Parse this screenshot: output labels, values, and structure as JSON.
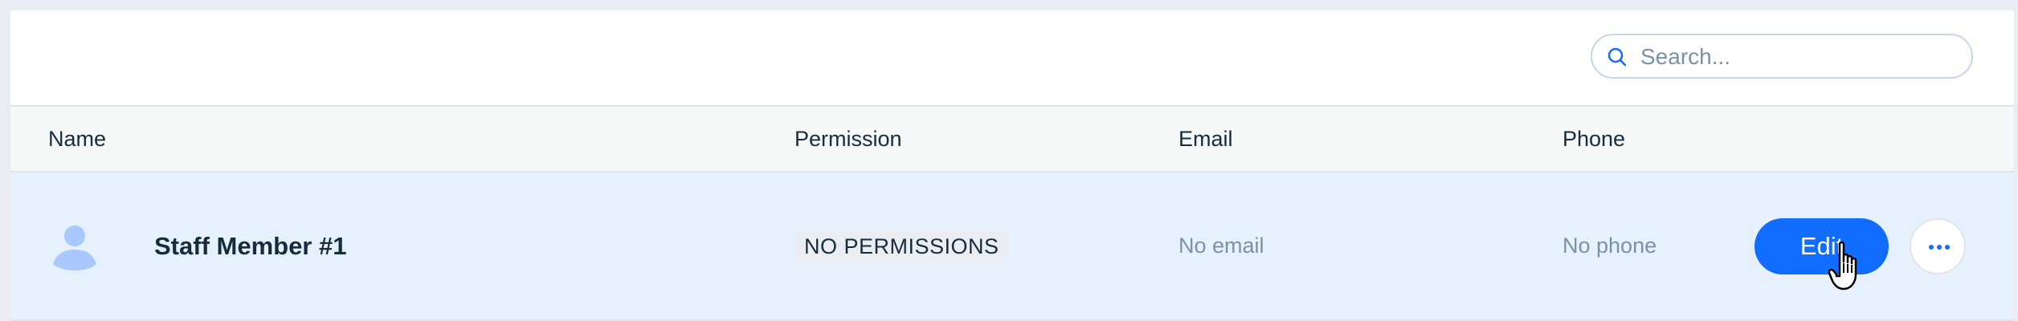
{
  "toolbar": {
    "search": {
      "placeholder": "Search...",
      "value": "",
      "icon": "search-icon"
    }
  },
  "table": {
    "columns": [
      "Name",
      "Permission",
      "Email",
      "Phone"
    ],
    "rows": [
      {
        "avatar_icon": "person-avatar-icon",
        "name": "Staff Member #1",
        "permission": "NO PERMISSIONS",
        "email": "No email",
        "phone": "No phone",
        "edit_label": "Edit",
        "more_icon": "more-actions-icon"
      }
    ]
  },
  "colors": {
    "accent": "#116DFF",
    "row_selected": "#E7F0FD",
    "header_bg": "#F6F7F7",
    "text_primary": "#162D3D",
    "text_muted": "#7A92A5",
    "avatar": "#A8C8FF"
  }
}
